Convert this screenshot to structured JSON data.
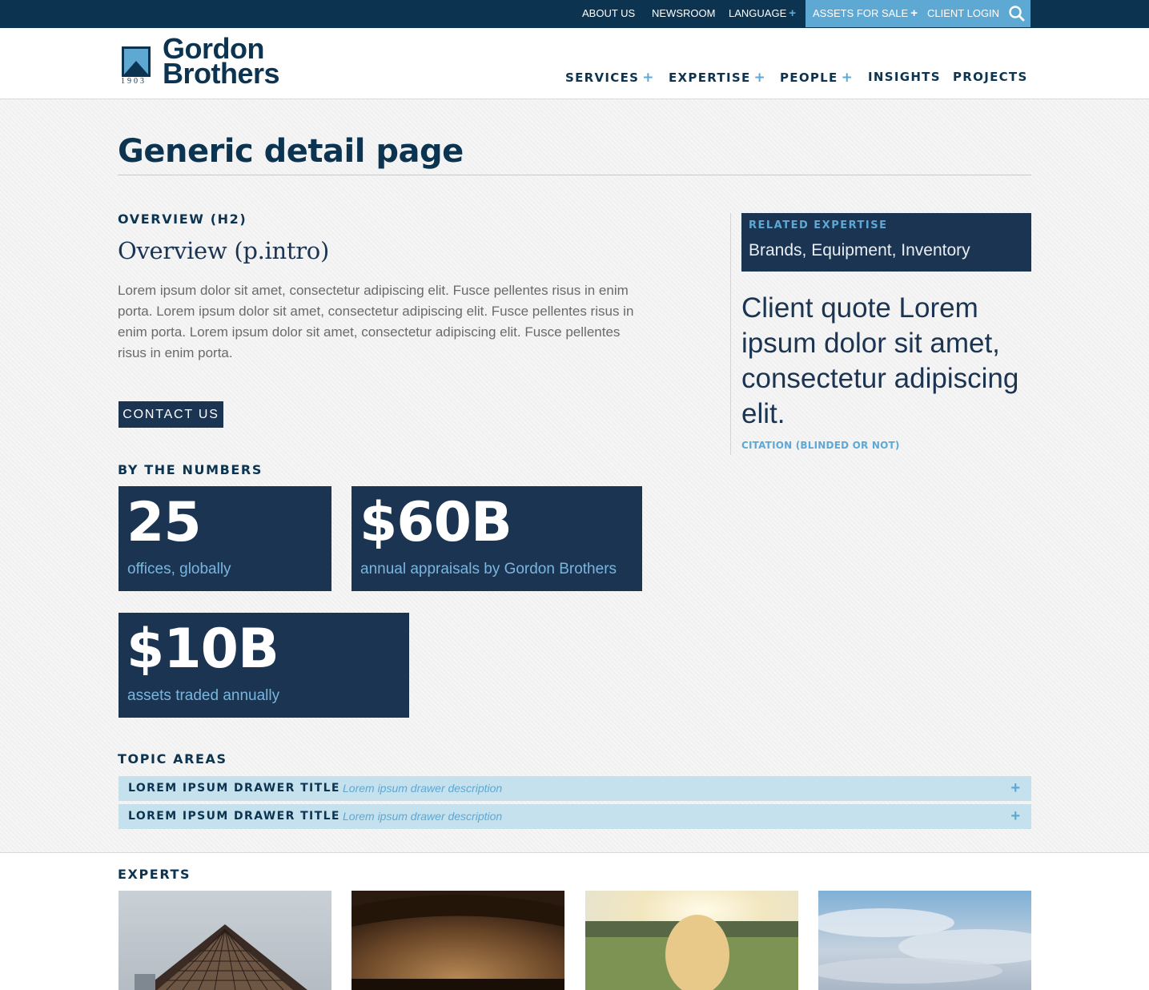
{
  "utility": {
    "about": "ABOUT US",
    "newsroom": "NEWSROOM",
    "language": "LANGUAGE",
    "assets": "ASSETS FOR SALE",
    "login": "CLIENT LOGIN",
    "plus": "+"
  },
  "brand": {
    "name_line1": "Gordon",
    "name_line2": "Brothers",
    "year": "1903",
    "colors": {
      "navy": "#0c3450",
      "accent": "#5ea8d4",
      "panel": "#1b3452",
      "drawer": "#c4e1ed"
    }
  },
  "nav": {
    "items": [
      {
        "label": "SERVICES",
        "plus": "+"
      },
      {
        "label": "EXPERTISE",
        "plus": "+"
      },
      {
        "label": "PEOPLE",
        "plus": "+"
      },
      {
        "label": "INSIGHTS",
        "plus": ""
      },
      {
        "label": "PROJECTS",
        "plus": ""
      }
    ]
  },
  "page": {
    "title": "Generic detail page",
    "overview_heading": "OVERVIEW (H2)",
    "intro": "Overview (p.intro)",
    "body": "Lorem ipsum dolor sit amet, consectetur adipiscing elit. Fusce pellentes risus in enim porta. Lorem ipsum dolor sit amet, consectetur adipiscing elit. Fusce pellentes risus in enim porta. Lorem ipsum dolor sit amet, consectetur adipiscing elit. Fusce pellentes risus in enim porta.",
    "contact_label": "CONTACT US",
    "numbers_heading": "BY THE NUMBERS",
    "stats": [
      {
        "value": "25",
        "label": "offices, globally"
      },
      {
        "value": "$60B",
        "label": "annual appraisals by Gordon Brothers"
      },
      {
        "value": "$10B",
        "label": "assets traded annually"
      }
    ],
    "topics_heading": "TOPIC AREAS",
    "drawers": [
      {
        "title": "LOREM IPSUM DRAWER TITLE",
        "description": "Lorem ipsum drawer description",
        "plus": "+"
      },
      {
        "title": "LOREM IPSUM DRAWER TITLE",
        "description": "Lorem ipsum drawer description",
        "plus": "+"
      }
    ],
    "experts_heading": "EXPERTS"
  },
  "sidebar": {
    "related_label": "RELATED EXPERTISE",
    "related_value": "Brands, Equipment, Inventory",
    "quote": "Client quote Lorem ipsum dolor sit amet, consectetur adipiscing elit.",
    "citation": "CITATION (BLINDED OR NOT)"
  },
  "icons": {
    "search": "search-icon",
    "logo": "logo-mark-icon",
    "expand": "plus-icon"
  }
}
